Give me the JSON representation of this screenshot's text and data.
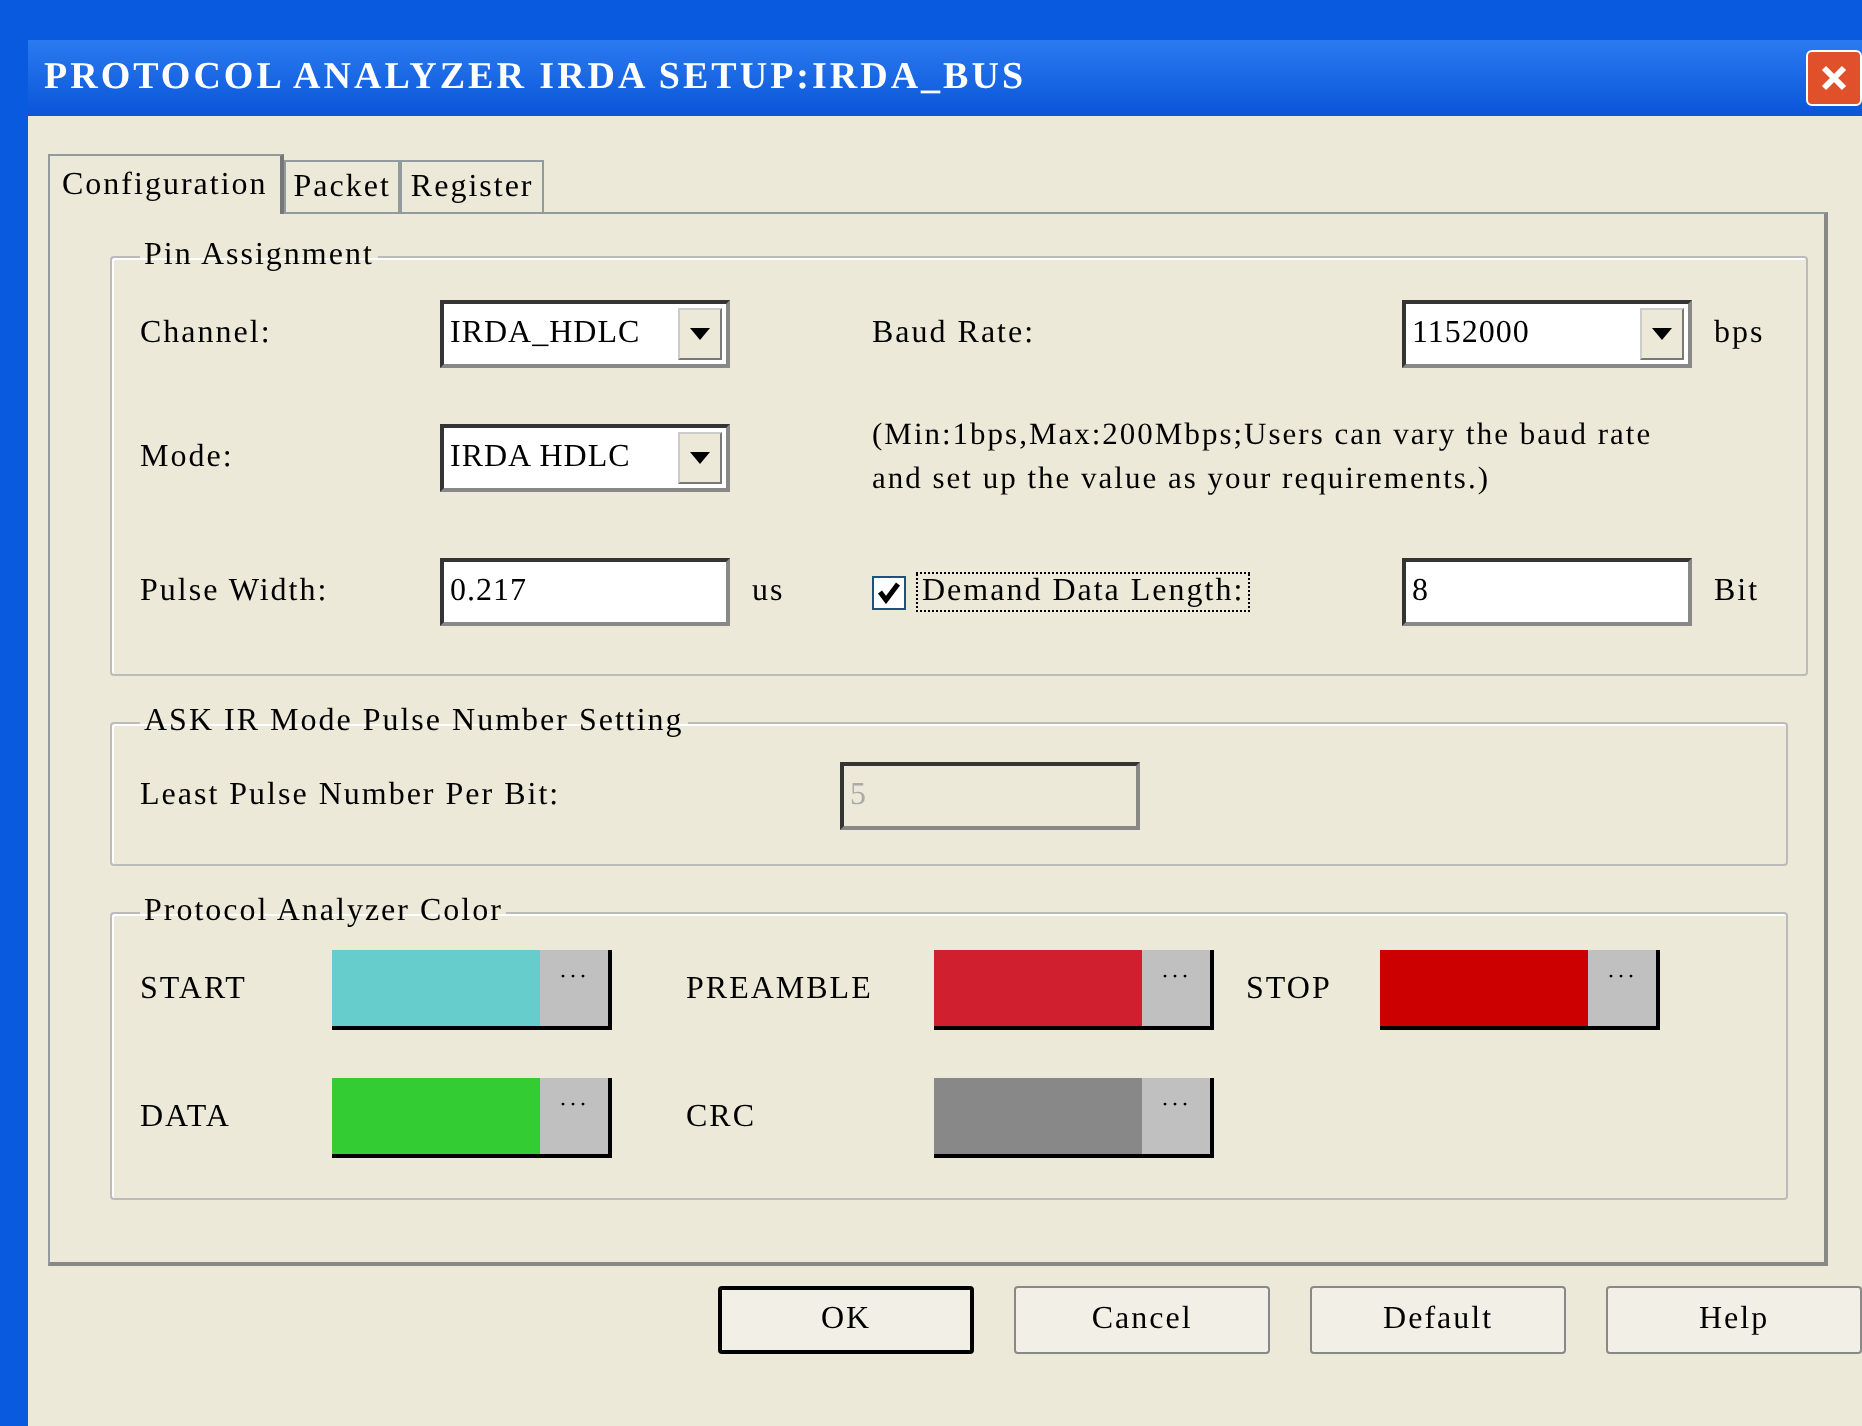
{
  "window": {
    "title": "PROTOCOL ANALYZER IRDA SETUP:IRDA_BUS"
  },
  "tabs": [
    {
      "label": "Configuration",
      "selected": true
    },
    {
      "label": "Packet",
      "selected": false
    },
    {
      "label": "Register",
      "selected": false
    }
  ],
  "pin_assignment": {
    "title": "Pin Assignment",
    "channel": {
      "label": "Channel:",
      "value": "IRDA_HDLC"
    },
    "mode": {
      "label": "Mode:",
      "value": "IRDA HDLC"
    },
    "pulse_width": {
      "label": "Pulse Width:",
      "value": "0.217",
      "unit": "us"
    },
    "baud_rate": {
      "label": "Baud Rate:",
      "value": "1152000",
      "unit": "bps"
    },
    "note": "(Min:1bps,Max:200Mbps;Users can vary the baud rate and set up the value as your requirements.)",
    "demand_data_length": {
      "label": "Demand Data Length:",
      "checked": true,
      "value": "8",
      "unit": "Bit"
    }
  },
  "ask_ir": {
    "title": "ASK IR Mode Pulse Number Setting",
    "label": "Least Pulse Number Per Bit:",
    "value": "5",
    "disabled": true
  },
  "colors": {
    "title": "Protocol Analyzer Color",
    "items": [
      {
        "label": "START",
        "color": "#66cccc"
      },
      {
        "label": "PREAMBLE",
        "color": "#d02030"
      },
      {
        "label": "STOP",
        "color": "#cc0000"
      },
      {
        "label": "DATA",
        "color": "#33cc33"
      },
      {
        "label": "CRC",
        "color": "#888888"
      }
    ],
    "button": "···"
  },
  "buttons": [
    {
      "label": "OK",
      "default": true
    },
    {
      "label": "Cancel",
      "default": false
    },
    {
      "label": "Default",
      "default": false
    },
    {
      "label": "Help",
      "default": false
    }
  ]
}
